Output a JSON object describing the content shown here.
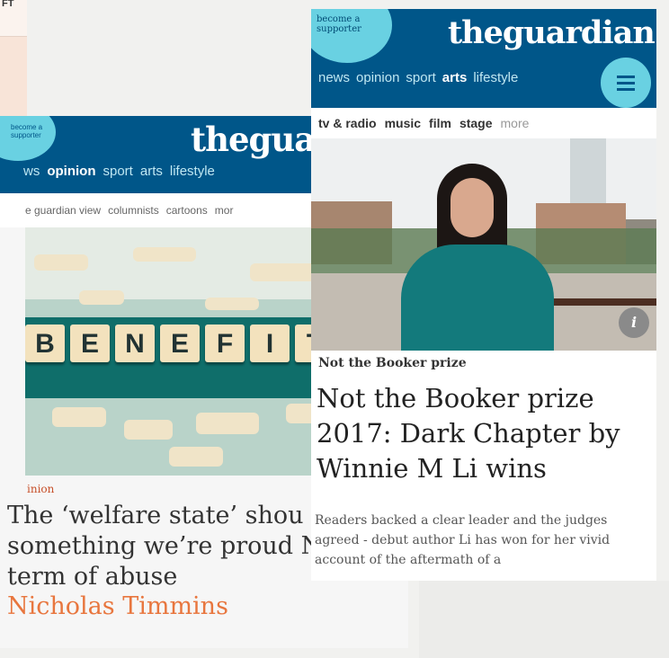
{
  "left_phone": {
    "visible_text": "FT"
  },
  "middle_phone": {
    "badge": "become a supporter",
    "logo": "theguar",
    "nav": [
      "ws",
      "opinion",
      "sport",
      "arts",
      "lifestyle"
    ],
    "nav_active": "opinion",
    "subnav": [
      "e guardian view",
      "columnists",
      "cartoons",
      "mor"
    ],
    "image_tiles": [
      "B",
      "E",
      "N",
      "E",
      "F",
      "I",
      "T"
    ],
    "kicker": "inion",
    "headline": "The ‘welfare state’ shou something we’re proud Not a term of abuse",
    "byline": "Nicholas Timmins",
    "byline_color": "#e8763e"
  },
  "right_phone": {
    "badge": "become a supporter",
    "logo": "theguardian",
    "nav": [
      "news",
      "opinion",
      "sport",
      "arts",
      "lifestyle"
    ],
    "nav_active": "arts",
    "menu_icon": "hamburger-icon",
    "subnav": [
      "tv & radio",
      "music",
      "film",
      "stage",
      "more"
    ],
    "image_info_icon": "i",
    "kicker": "Not the Booker prize",
    "headline": "Not the Booker prize 2017: Dark Chapter by Winnie M Li wins",
    "standfirst": "Readers backed a clear leader and the judges agreed - debut author Li has won for her vivid account of the aftermath of a",
    "brand_color": "#005689",
    "accent_color": "#69d1e2"
  }
}
